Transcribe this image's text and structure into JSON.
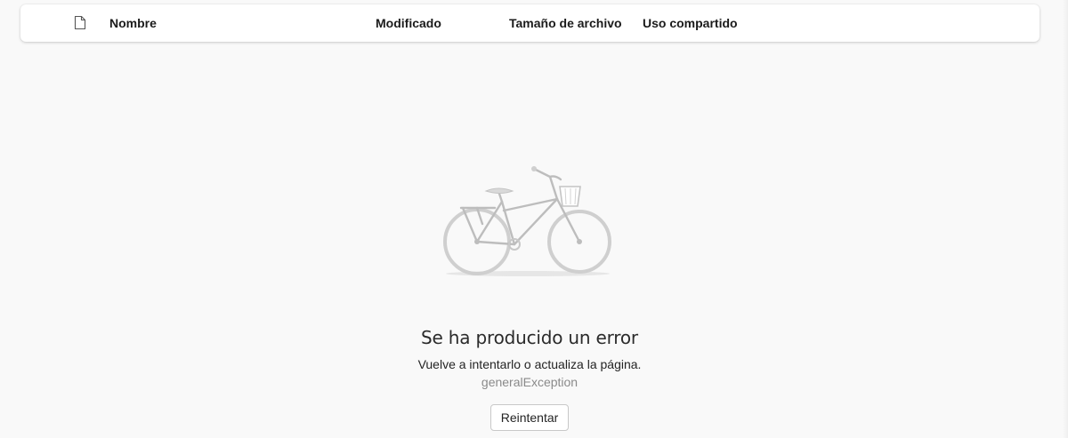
{
  "header": {
    "columns": {
      "icon": "file-icon",
      "name": "Nombre",
      "modified": "Modificado",
      "size": "Tamaño de archivo",
      "sharing": "Uso compartido"
    }
  },
  "error": {
    "illustration": "bicycle-illustration",
    "title": "Se ha producido un error",
    "message": "Vuelve a intentarlo o actualiza la página.",
    "code": "generalException",
    "retry_label": "Reintentar"
  },
  "colors": {
    "background": "#f9f9f9",
    "header_bg": "#ffffff",
    "illustration_gray": "#c8c8c8",
    "muted_text": "#8a8a8a"
  }
}
